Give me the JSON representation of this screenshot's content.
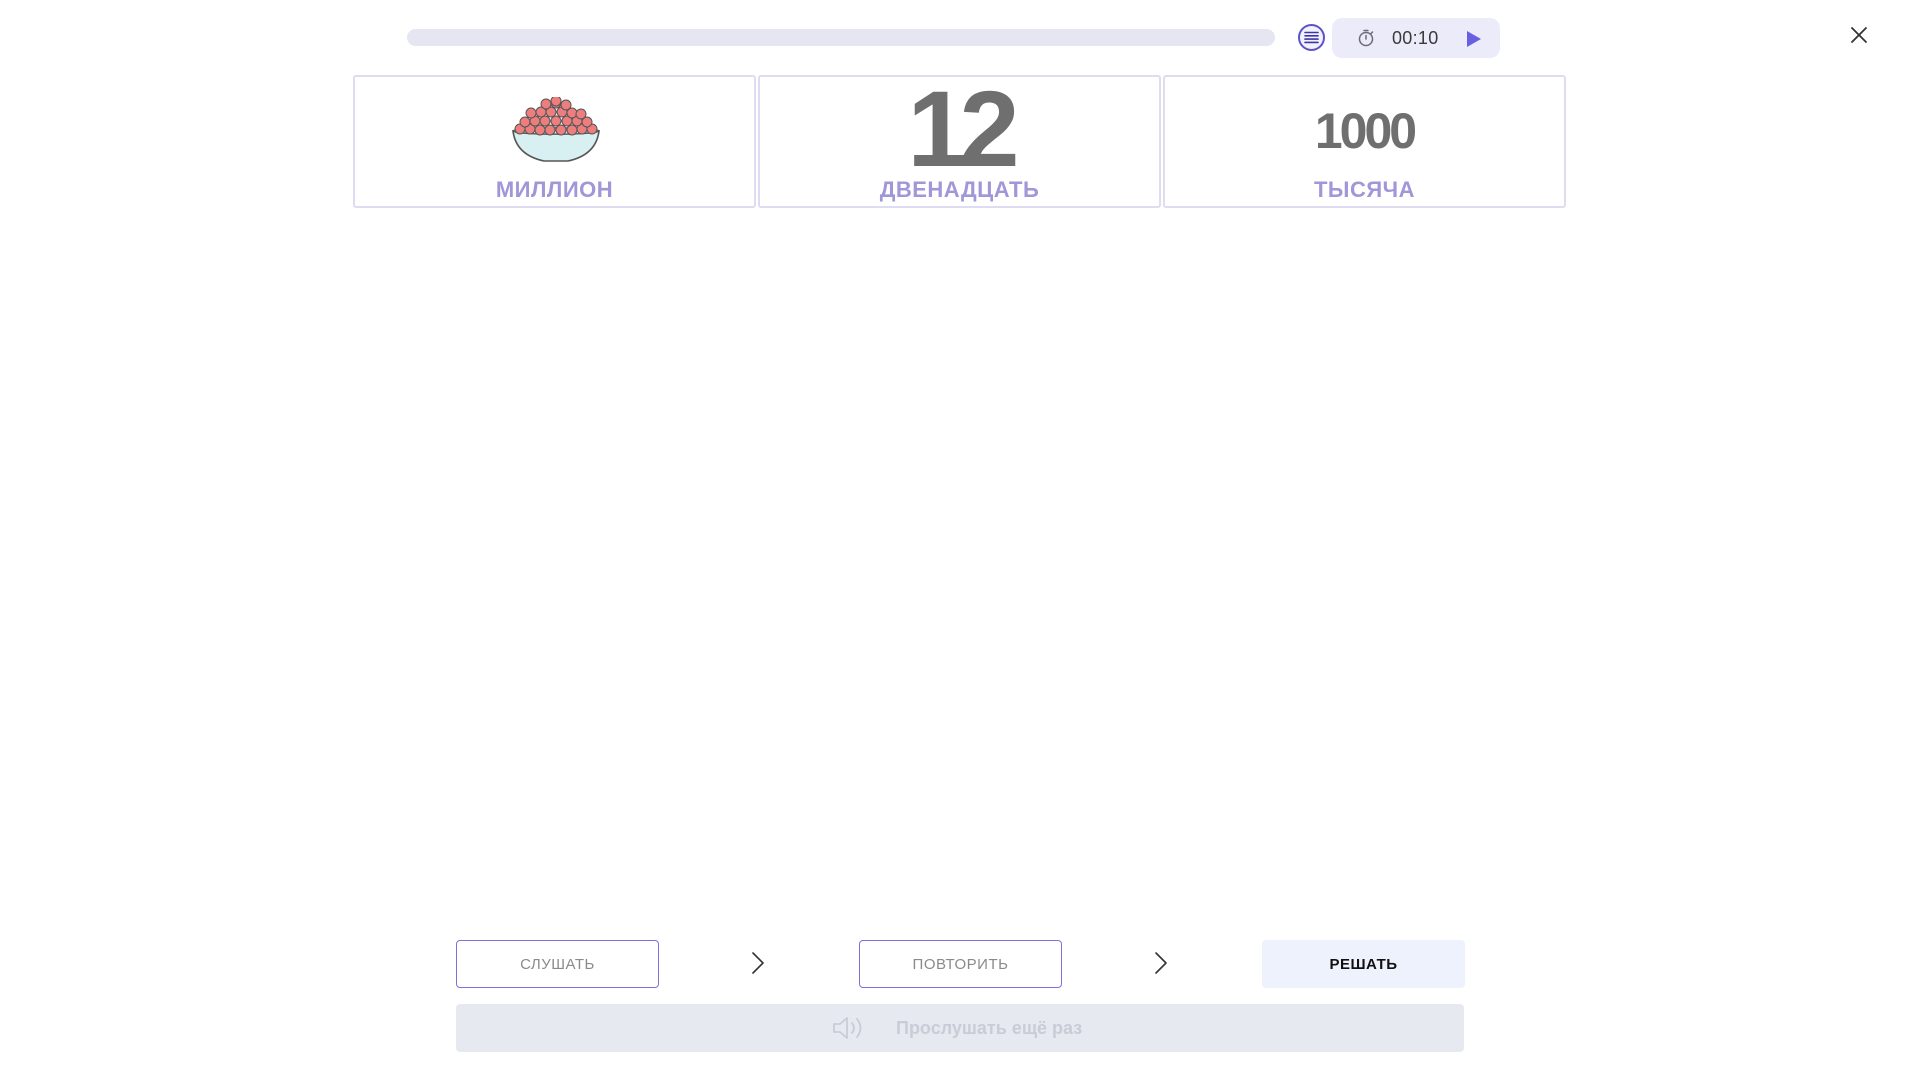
{
  "header": {
    "progress_percent": 0,
    "timer": "00:10",
    "icons": {
      "list": "list-icon",
      "timer": "stopwatch-icon",
      "play": "play-icon",
      "close": "close-icon"
    }
  },
  "cards": [
    {
      "kind": "image",
      "image": "bowl-of-caviar",
      "label": "МИЛЛИОН"
    },
    {
      "kind": "number",
      "number": "12",
      "label": "ДВЕНАДЦАТЬ"
    },
    {
      "kind": "number",
      "number": "1000",
      "label": "ТЫСЯЧА"
    }
  ],
  "steps": [
    {
      "label": "СЛУШАТЬ"
    },
    {
      "label": "ПОВТОРИТЬ"
    },
    {
      "label": "РЕШАТЬ"
    }
  ],
  "replay": {
    "label": "Прослушать ещё раз",
    "icon": "speaker-icon"
  },
  "colors": {
    "accent": "#7c73d9",
    "label_purple": "#a097d8",
    "number_gray": "#6f6f6f",
    "pill_bg": "#ecebfa",
    "solid_button_bg": "#eef2fd",
    "disabled_bar_bg": "#e6e9ef"
  }
}
